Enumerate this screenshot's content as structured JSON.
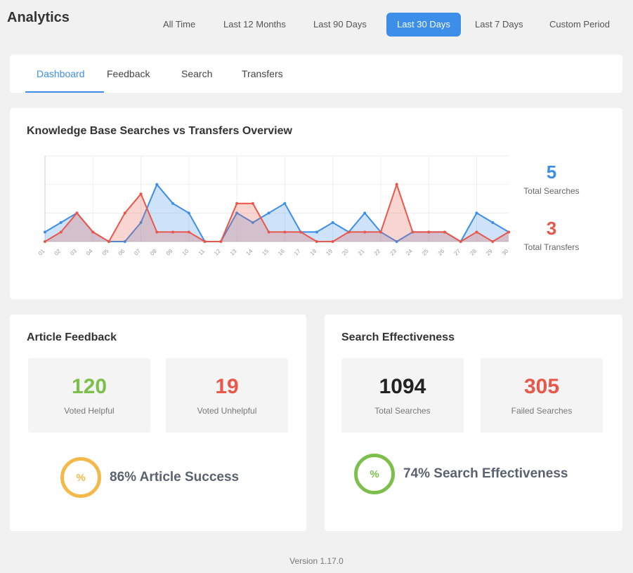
{
  "header": {
    "title": "Analytics",
    "ranges": [
      "All Time",
      "Last 12 Months",
      "Last 90 Days",
      "Last 30 Days",
      "Last 7 Days",
      "Custom Period"
    ],
    "active_range": "Last 30 Days"
  },
  "tabs": [
    "Dashboard",
    "Feedback",
    "Search",
    "Transfers"
  ],
  "active_tab": "Dashboard",
  "overview": {
    "title": "Knowledge Base Searches vs Transfers Overview",
    "legend": [
      {
        "value": "5",
        "label": "Total Searches",
        "color": "#3d8ee8"
      },
      {
        "value": "3",
        "label": "Total Transfers",
        "color": "#e8574a"
      }
    ]
  },
  "chart_data": {
    "type": "area",
    "x": [
      "01",
      "02",
      "03",
      "04",
      "05",
      "06",
      "07",
      "08",
      "09",
      "10",
      "11",
      "12",
      "13",
      "14",
      "15",
      "16",
      "17",
      "18",
      "19",
      "20",
      "21",
      "22",
      "23",
      "24",
      "25",
      "26",
      "27",
      "28",
      "29",
      "30"
    ],
    "series": [
      {
        "name": "Total Searches",
        "color": "#3d8ee8",
        "values": [
          1,
          2,
          3,
          1,
          0,
          0,
          2,
          6,
          4,
          3,
          0,
          0,
          3,
          2,
          3,
          4,
          1,
          1,
          2,
          1,
          3,
          1,
          0,
          1,
          1,
          1,
          0,
          3,
          2,
          1
        ]
      },
      {
        "name": "Total Transfers",
        "color": "#e8574a",
        "values": [
          0,
          1,
          3,
          1,
          0,
          3,
          5,
          1,
          1,
          1,
          0,
          0,
          4,
          4,
          1,
          1,
          1,
          0,
          0,
          1,
          1,
          1,
          6,
          1,
          1,
          1,
          0,
          1,
          0,
          1
        ]
      }
    ],
    "ylim": [
      0,
      9
    ],
    "grid": true,
    "legend": "right"
  },
  "article_feedback": {
    "title": "Article Feedback",
    "helpful": {
      "value": "120",
      "label": "Voted Helpful",
      "color": "#7cc04b"
    },
    "unhelpful": {
      "value": "19",
      "label": "Voted Unhelpful",
      "color": "#e8574a"
    },
    "success": {
      "ring_text": "%",
      "text": "86% Article Success",
      "color": "#f3b94a"
    }
  },
  "search_effectiveness": {
    "title": "Search Effectiveness",
    "total": {
      "value": "1094",
      "label": "Total Searches",
      "color": "#222"
    },
    "failed": {
      "value": "305",
      "label": "Failed Searches",
      "color": "#e8574a"
    },
    "success": {
      "ring_text": "%",
      "text": "74% Search Effectiveness",
      "color": "#7cc04b"
    }
  },
  "footer": {
    "version": "Version 1.17.0"
  }
}
